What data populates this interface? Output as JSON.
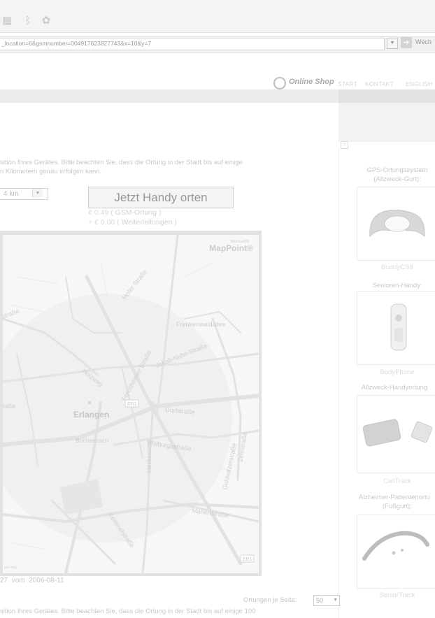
{
  "browser": {
    "address": "_location=6&gsmnumber=004917623827743&x=10&y=7",
    "go_label": "Wech"
  },
  "header": {
    "shop_label": "Online Shop",
    "nav": [
      "START",
      "KONTAKT",
      "ENGLISH"
    ]
  },
  "intro": {
    "line1": "sition Ihres Gerätes. Bitte beachten Sie, dass die Ortung in der Stadt bis auf einige",
    "line2": "n Kilometern genau erfolgen kann."
  },
  "radius_select": {
    "value": "4 km"
  },
  "locate_button": "Jetzt Handy orten",
  "pricing": {
    "gsm_price": "€ 0.49",
    "gsm_label": "( GSM-Ortung )",
    "fwd_price": "+ € 0.00",
    "fwd_label": "( Weiterleitungen )"
  },
  "map": {
    "brand_small": "Microsoft®",
    "brand": "MapPoint®",
    "city": "Erlangen",
    "district": "Büchenbach",
    "streets": [
      "Hofer Straße",
      "Frankenwaldallee",
      "Forchheimer Straße",
      "Jakob-Nuhn-Straße",
      "Holzweg",
      "Dorfstraße",
      "Walburgastraße",
      "Heckenweg",
      "Zeisstraße",
      "Goldwitzerstraße",
      "Marienstraße",
      "Kemmelstraße",
      "straße",
      "raße"
    ],
    "route_label": "ER1",
    "route_label2": "ER1",
    "copyright": "NAVTEQ"
  },
  "result": {
    "time_fragment": "27",
    "vom": "vom",
    "date": "2006-08-11"
  },
  "pagination": {
    "label": "Ortungen je Seite:",
    "value": "50"
  },
  "footer_text": "sition Ihres Gerätes. Bitte beachten Sie, dass die Ortung in der Stadt bis auf einige 100",
  "sidebar": {
    "collapse_glyph": "«",
    "products": [
      {
        "title": "GPS-Ortungssystem",
        "subtitle": "(Allzweck-Gurt):",
        "name": "BuddyCS8"
      },
      {
        "title": "Senioren-Handy:",
        "subtitle": "",
        "name": "BodyPhone"
      },
      {
        "title": "Allzweck-Handyortung",
        "subtitle": "",
        "name": "CellTrack"
      },
      {
        "title": "Alzheimer-Patientenortu",
        "subtitle": "(Fußgurt):",
        "name": "SeniorTrack"
      }
    ]
  }
}
